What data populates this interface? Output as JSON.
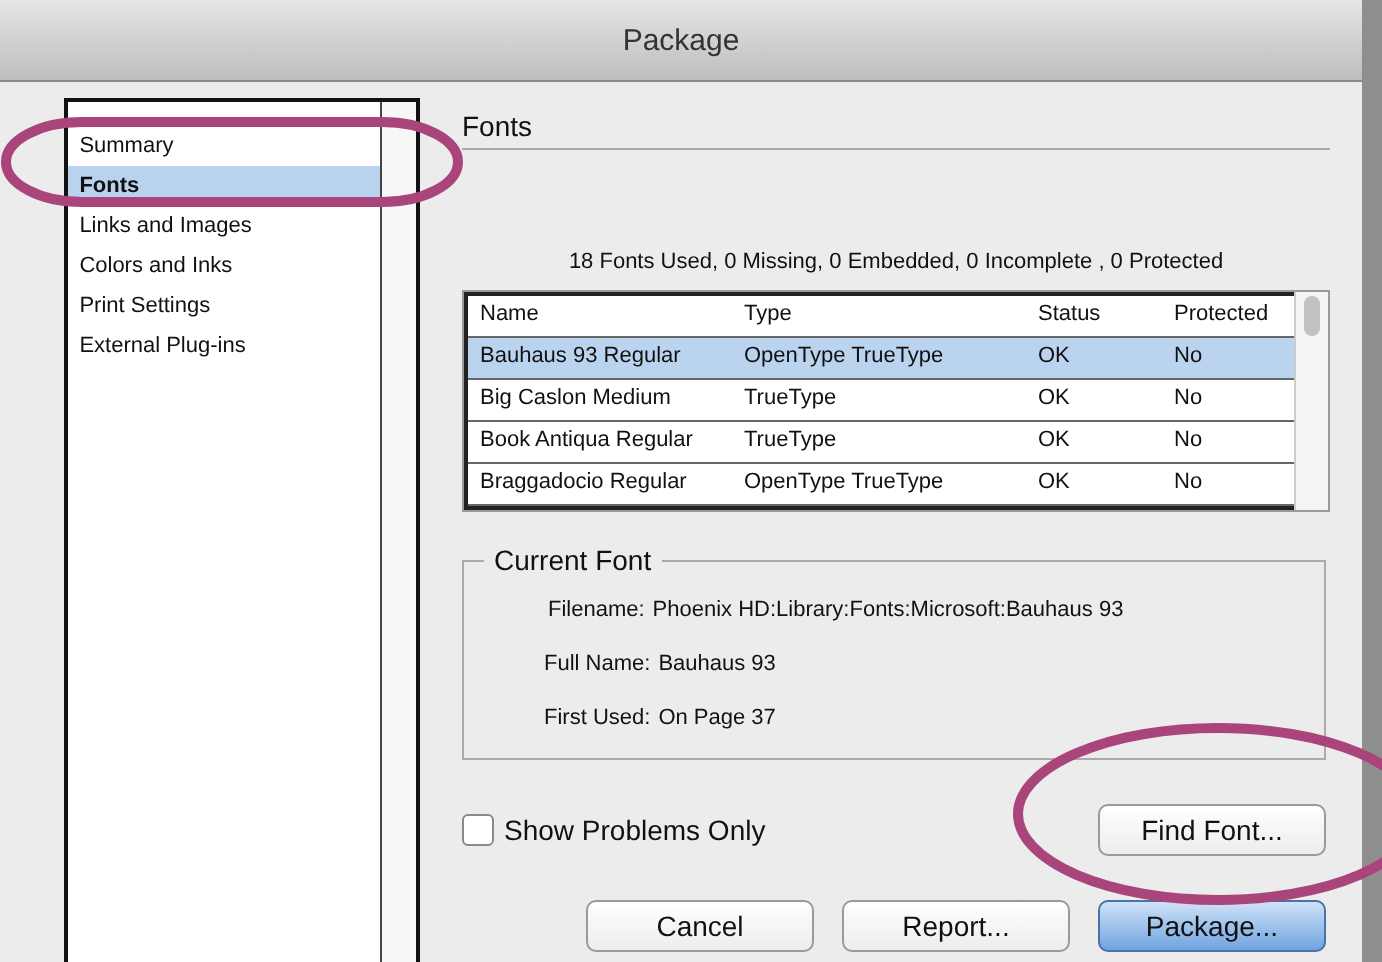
{
  "window": {
    "title": "Package"
  },
  "sidebar": {
    "items": [
      {
        "label": "Summary",
        "selected": false
      },
      {
        "label": "Fonts",
        "selected": true
      },
      {
        "label": "Links and Images",
        "selected": false
      },
      {
        "label": "Colors and Inks",
        "selected": false
      },
      {
        "label": "Print Settings",
        "selected": false
      },
      {
        "label": "External Plug-ins",
        "selected": false
      }
    ]
  },
  "section_title": "Fonts",
  "summary": "18 Fonts Used, 0 Missing, 0 Embedded, 0 Incomplete , 0 Protected",
  "table": {
    "columns": [
      "Name",
      "Type",
      "Status",
      "Protected"
    ],
    "rows": [
      {
        "cells": [
          "Bauhaus 93 Regular",
          "OpenType TrueType",
          "OK",
          "No"
        ],
        "selected": true
      },
      {
        "cells": [
          "Big Caslon Medium",
          "TrueType",
          "OK",
          "No"
        ],
        "selected": false
      },
      {
        "cells": [
          "Book Antiqua Regular",
          "TrueType",
          "OK",
          "No"
        ],
        "selected": false
      },
      {
        "cells": [
          "Braggadocio Regular",
          "OpenType TrueType",
          "OK",
          "No"
        ],
        "selected": false
      }
    ]
  },
  "current_font": {
    "title": "Current Font",
    "fields": [
      {
        "label": "Filename:",
        "value": "Phoenix HD:Library:Fonts:Microsoft:Bauhaus 93"
      },
      {
        "label": "Full Name:",
        "value": "Bauhaus 93"
      },
      {
        "label": "First Used:",
        "value": "On Page 37"
      }
    ]
  },
  "show_problems_only": {
    "label": "Show Problems Only",
    "checked": false
  },
  "find_font_button": "Find Font...",
  "buttons": [
    {
      "label": "Cancel",
      "default": false
    },
    {
      "label": "Report...",
      "default": false
    },
    {
      "label": "Package...",
      "default": true
    }
  ]
}
